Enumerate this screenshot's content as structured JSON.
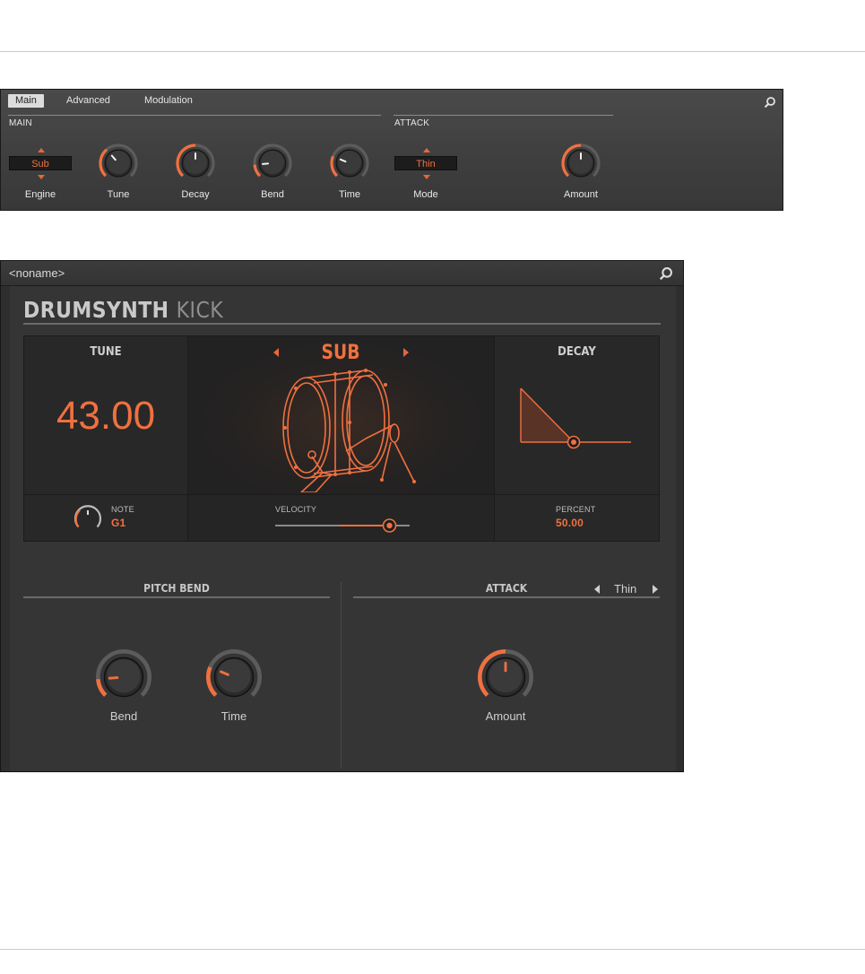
{
  "strip": {
    "tabs": [
      "Main",
      "Advanced",
      "Modulation"
    ],
    "active_tab": "Main",
    "sections": [
      "MAIN",
      "ATTACK"
    ],
    "engine": {
      "value": "Sub",
      "label": "Engine"
    },
    "knobs": [
      {
        "label": "Tune",
        "level": 0.35
      },
      {
        "label": "Decay",
        "level": 0.5
      },
      {
        "label": "Bend",
        "level": 0.15
      },
      {
        "label": "Time",
        "level": 0.25
      },
      {
        "label": "Amount",
        "level": 0.5
      }
    ],
    "mode": {
      "value": "Thin",
      "label": "Mode"
    }
  },
  "panel": {
    "preset_name": "<noname>",
    "brand_bold": "DRUMSYNTH",
    "brand_thin": "KICK",
    "tune": {
      "title": "TUNE",
      "value": "43.00"
    },
    "engine_display": "SUB",
    "decay": {
      "title": "DECAY"
    },
    "note": {
      "label": "NOTE",
      "value": "G1"
    },
    "velocity": {
      "label": "VELOCITY",
      "level": 0.85
    },
    "percent": {
      "label": "PERCENT",
      "value": "50.00"
    },
    "pitch_bend": {
      "title": "PITCH BEND",
      "knobs": [
        {
          "label": "Bend",
          "level": 0.15
        },
        {
          "label": "Time",
          "level": 0.25
        }
      ]
    },
    "attack": {
      "title": "ATTACK",
      "mode": "Thin",
      "knobs": [
        {
          "label": "Amount",
          "level": 0.5
        }
      ]
    }
  },
  "colors": {
    "accent": "#f07040",
    "panel_bg": "#353535",
    "strip_bg": "#444444"
  }
}
